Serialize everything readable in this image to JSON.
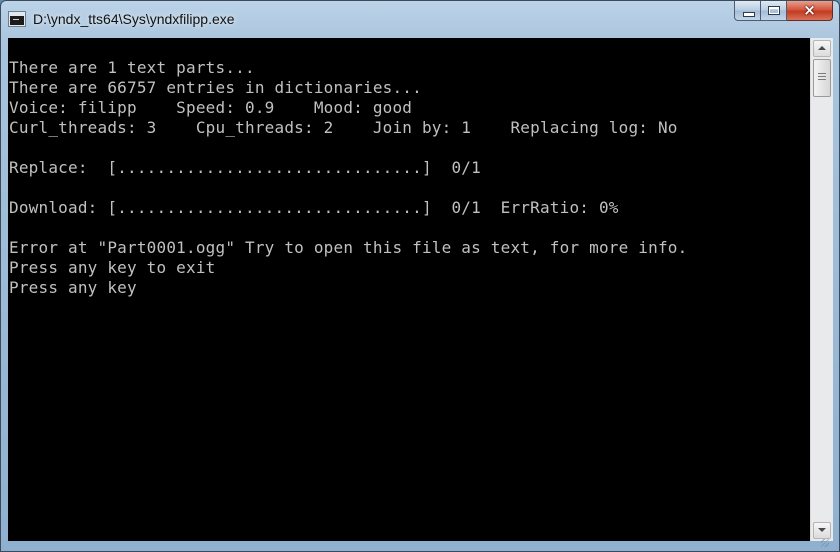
{
  "window": {
    "title": "D:\\yndx_tts64\\Sys\\yndxfilipp.exe",
    "close_glyph": "×"
  },
  "icons": {
    "app": "console-app-icon",
    "minimize": "minimize-icon",
    "maximize": "maximize-icon",
    "close": "close-icon"
  },
  "console": {
    "lines": [
      "There are 1 text parts...",
      "There are 66757 entries in dictionaries...",
      "Voice: filipp    Speed: 0.9    Mood: good",
      "Curl_threads: 3    Cpu_threads: 2    Join by: 1    Replacing log: No",
      "",
      "Replace:  [...............................]  0/1",
      "",
      "Download: [...............................]  0/1  ErrRatio: 0%",
      "",
      "Error at \"Part0001.ogg\" Try to open this file as text, for more info.",
      "Press any key to exit",
      "Press any key"
    ],
    "foreground": "#c0c0c0",
    "background": "#000000"
  }
}
